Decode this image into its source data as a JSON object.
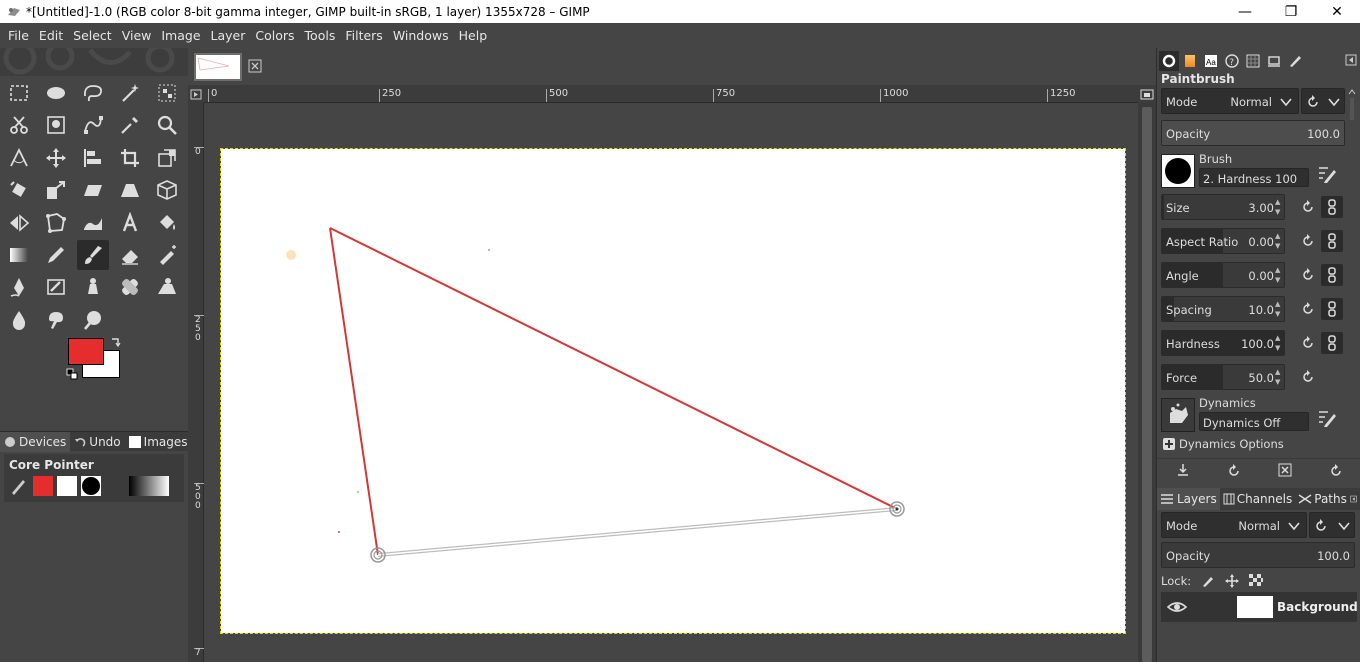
{
  "window": {
    "title": "*[Untitled]-1.0 (RGB color 8-bit gamma integer, GIMP built-in sRGB, 1 layer) 1355x728 – GIMP",
    "minimize": "—",
    "maximize": "❐",
    "close": "✕"
  },
  "menubar": [
    "File",
    "Edit",
    "Select",
    "View",
    "Image",
    "Layer",
    "Colors",
    "Tools",
    "Filters",
    "Windows",
    "Help"
  ],
  "colors": {
    "foreground": "#e52d2d",
    "background": "#ffffff",
    "stroke": "#d63636",
    "path": "#c8c8c8"
  },
  "toolbox": {
    "tools": [
      "rect-select-icon",
      "ellipse-select-icon",
      "free-select-icon",
      "fuzzy-select-icon",
      "select-by-color-icon",
      "scissors-select-icon",
      "foreground-select-icon",
      "paths-icon",
      "color-picker-icon",
      "zoom-icon",
      "measure-icon",
      "move-icon",
      "align-icon",
      "crop-icon",
      "unified-transform-icon",
      "rotate-icon",
      "scale-icon",
      "shear-icon",
      "perspective-icon",
      "3d-transform-icon",
      "flip-icon",
      "cage-transform-icon",
      "warp-transform-icon",
      "text-icon",
      "bucket-fill-icon",
      "blend-icon",
      "pencil-icon",
      "paintbrush-icon",
      "eraser-icon",
      "airbrush-icon",
      "ink-icon",
      "mypaint-brush-icon",
      "clone-icon",
      "heal-icon",
      "perspective-clone-icon",
      "blur-icon",
      "smudge-icon",
      "dodge-burn-icon"
    ],
    "active_tool": "paintbrush-icon",
    "dock_tabs": [
      "Devices",
      "Undo",
      "Images"
    ],
    "core_pointer_label": "Core Pointer"
  },
  "image_tab": {
    "close_label": "⊠"
  },
  "rulers": {
    "h_ticks": [
      "0",
      "250",
      "500",
      "750",
      "1000",
      "1250"
    ],
    "v_ticks": [
      "0",
      "2\n5\n0",
      "5\n0\n0",
      "7"
    ]
  },
  "tool_options": {
    "tabs": [
      "tool-options-icon",
      "gradient-icon",
      "fonts-icon",
      "help-icon",
      "patterns-icon",
      "device-icon",
      "paint-icon"
    ],
    "title": "Paintbrush",
    "mode_label": "Mode",
    "mode_value": "Normal",
    "opacity": {
      "label": "Opacity",
      "value": "100.0",
      "fraction": 1.0
    },
    "brush_label": "Brush",
    "brush_name": "2. Hardness 100",
    "sliders": [
      {
        "label": "Size",
        "value": "3.00",
        "fraction": 0.02,
        "linked": true
      },
      {
        "label": "Aspect Ratio",
        "value": "0.00",
        "fraction": 0.5,
        "linked": true
      },
      {
        "label": "Angle",
        "value": "0.00",
        "fraction": 0.5,
        "linked": true
      },
      {
        "label": "Spacing",
        "value": "10.0",
        "fraction": 0.1,
        "linked": true
      },
      {
        "label": "Hardness",
        "value": "100.0",
        "fraction": 1.0,
        "linked": true
      },
      {
        "label": "Force",
        "value": "50.0",
        "fraction": 0.5,
        "linked": false
      }
    ],
    "dynamics_label": "Dynamics",
    "dynamics_value": "Dynamics Off",
    "dynamics_options": "Dynamics Options"
  },
  "layers": {
    "tabs": [
      "Layers",
      "Channels",
      "Paths"
    ],
    "mode_label": "Mode",
    "mode_value": "Normal",
    "opacity_label": "Opacity",
    "opacity_value": "100.0",
    "lock_label": "Lock:",
    "layer_name": "Background"
  }
}
